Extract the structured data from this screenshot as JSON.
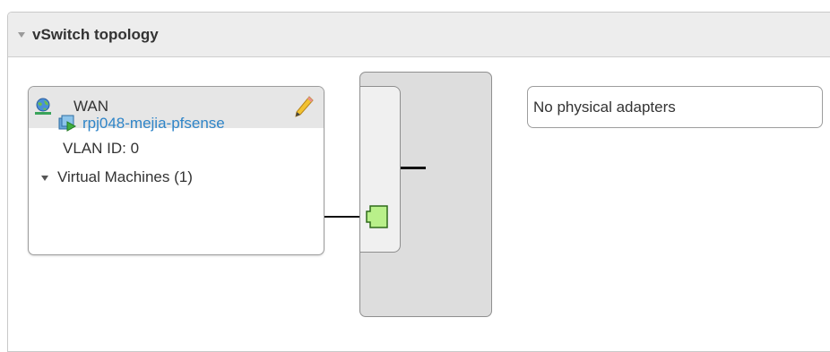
{
  "panel": {
    "title": "vSwitch topology",
    "collapse_icon": "caret-down-icon"
  },
  "port_group": {
    "name": "WAN",
    "icon": "globe-network-icon",
    "edit_icon": "pencil-icon",
    "vlan_text": "VLAN ID: 0",
    "vm_section_label": "Virtual Machines (1)",
    "virtual_machines": [
      {
        "name": "rpj048-mejia-pfsense",
        "icon": "vm-icon"
      }
    ]
  },
  "switch": {
    "port_icon": "switch-port-icon"
  },
  "physical_adapters": {
    "text": "No physical adapters"
  },
  "colors": {
    "link": "#2f85c8",
    "header_bg": "#ededed",
    "switch_bg": "#dddddd",
    "port_green": "#b9f08a"
  }
}
